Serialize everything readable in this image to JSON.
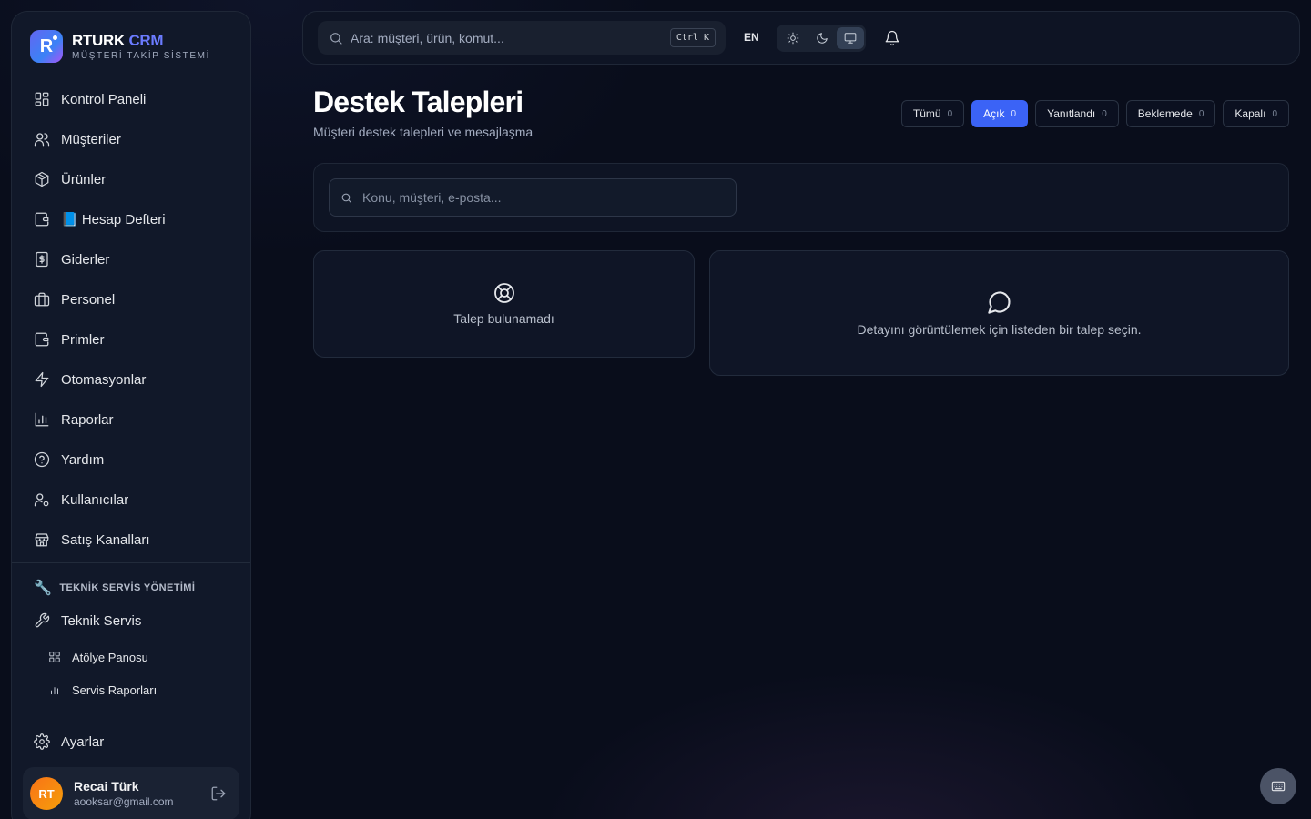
{
  "brand": {
    "name": "RTURK",
    "name_accent": "CRM",
    "subtitle": "MÜŞTERİ TAKİP SİSTEMİ",
    "logo_letter": "R"
  },
  "sidebar": {
    "items": [
      {
        "label": "Kontrol Paneli",
        "icon": "grid-icon"
      },
      {
        "label": "Müşteriler",
        "icon": "users-icon"
      },
      {
        "label": "Ürünler",
        "icon": "package-icon"
      },
      {
        "label": "📘 Hesap Defteri",
        "icon": "wallet-icon"
      },
      {
        "label": "Giderler",
        "icon": "receipt-icon"
      },
      {
        "label": "Personel",
        "icon": "briefcase-icon"
      },
      {
        "label": "Primler",
        "icon": "wallet-icon"
      },
      {
        "label": "Otomasyonlar",
        "icon": "zap-icon"
      },
      {
        "label": "Raporlar",
        "icon": "bar-chart-icon"
      },
      {
        "label": "Yardım",
        "icon": "help-circle-icon"
      },
      {
        "label": "Kullanıcılar",
        "icon": "user-cog-icon"
      },
      {
        "label": "Satış Kanalları",
        "icon": "store-icon"
      }
    ],
    "section_title": "TEKNİK SERVİS YÖNETİMİ",
    "section_icon": "🔧",
    "service": {
      "label": "Teknik Servis",
      "icon": "wrench-icon"
    },
    "service_sub": [
      {
        "label": "Atölye Panosu",
        "icon": "grid-icon"
      },
      {
        "label": "Servis Raporları",
        "icon": "bar-chart-icon"
      }
    ],
    "settings": {
      "label": "Ayarlar",
      "icon": "gear-icon"
    }
  },
  "user": {
    "initials": "RT",
    "name": "Recai Türk",
    "email": "aooksar@gmail.com"
  },
  "topbar": {
    "search_placeholder": "Ara: müşteri, ürün, komut...",
    "shortcut": "Ctrl K",
    "language": "EN",
    "theme_active": "system"
  },
  "page": {
    "title": "Destek Talepleri",
    "subtitle": "Müşteri destek talepleri ve mesajlaşma",
    "filters": [
      {
        "label": "Tümü",
        "count": "0",
        "active": false
      },
      {
        "label": "Açık",
        "count": "0",
        "active": true
      },
      {
        "label": "Yanıtlandı",
        "count": "0",
        "active": false
      },
      {
        "label": "Beklemede",
        "count": "0",
        "active": false
      },
      {
        "label": "Kapalı",
        "count": "0",
        "active": false
      }
    ],
    "search_placeholder": "Konu, müşteri, e-posta...",
    "empty_list": "Talep bulunamadı",
    "empty_detail": "Detayını görüntülemek için listeden bir talep seçin."
  },
  "colors": {
    "accent": "#3b63f6",
    "brand_accent": "#6b7bff",
    "background": "#090d1b",
    "avatar": "#f97316"
  }
}
